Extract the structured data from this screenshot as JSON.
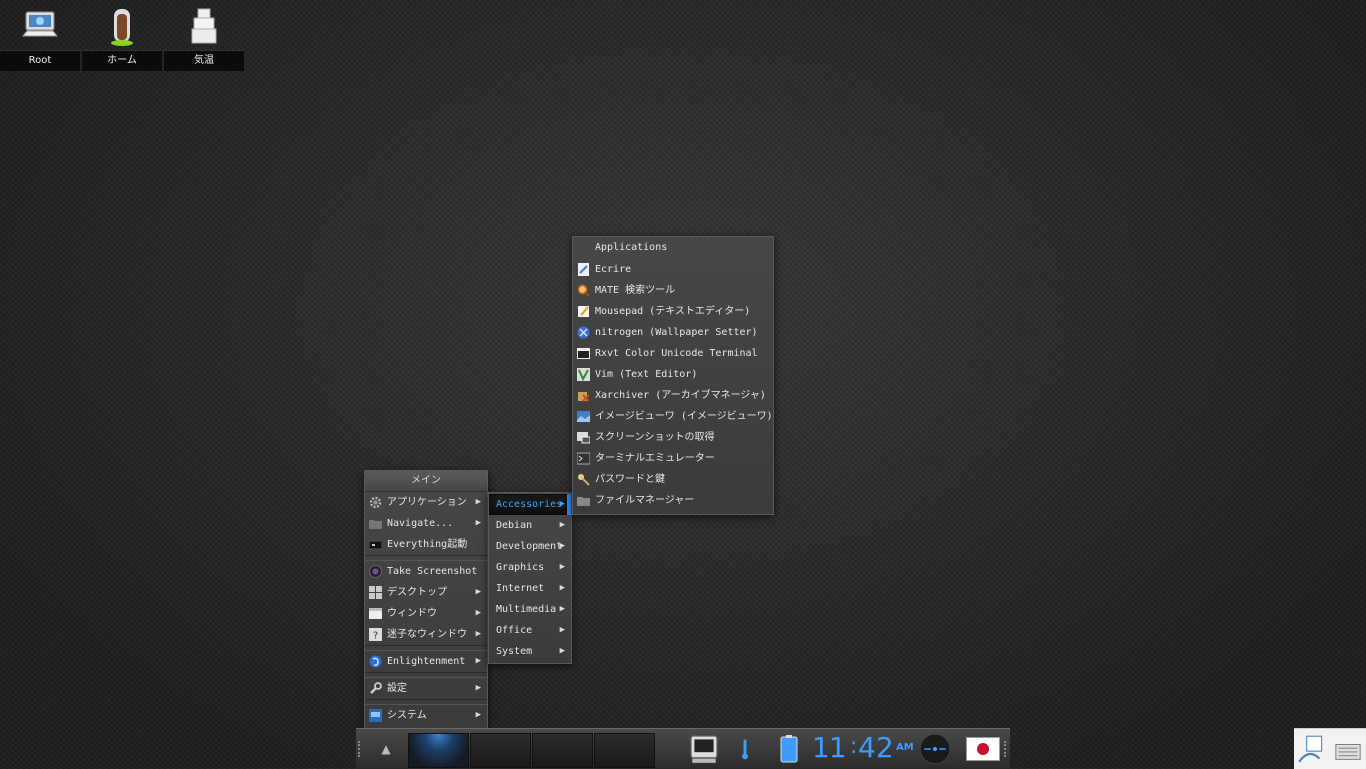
{
  "desktop_icons": [
    {
      "label": "Root",
      "icon": "computer-icon"
    },
    {
      "label": "ホーム",
      "icon": "home-door-icon"
    },
    {
      "label": "気温",
      "icon": "weather-icon"
    }
  ],
  "main_menu": {
    "title": "メイン",
    "items": [
      {
        "label": "アプリケーション",
        "icon": "gear-icon",
        "submenu": true
      },
      {
        "label": "Navigate...",
        "icon": "folder-icon",
        "submenu": true
      },
      {
        "label": "Everything起動",
        "icon": "launcher-icon",
        "submenu": false
      },
      {
        "label": "Take Screenshot",
        "icon": "camera-icon",
        "submenu": false
      },
      {
        "label": "デスクトップ",
        "icon": "desktop-grid-icon",
        "submenu": true
      },
      {
        "label": "ウィンドウ",
        "icon": "window-icon",
        "submenu": true
      },
      {
        "label": "迷子なウィンドウ",
        "icon": "question-icon",
        "submenu": true
      },
      {
        "label": "Enlightenment",
        "icon": "enlightenment-icon",
        "submenu": true
      },
      {
        "label": "設定",
        "icon": "wrench-icon",
        "submenu": true
      },
      {
        "label": "システム",
        "icon": "system-icon",
        "submenu": true
      }
    ]
  },
  "categories_menu": {
    "items": [
      {
        "label": "Accessories",
        "active": true
      },
      {
        "label": "Debian"
      },
      {
        "label": "Development"
      },
      {
        "label": "Graphics"
      },
      {
        "label": "Internet"
      },
      {
        "label": "Multimedia"
      },
      {
        "label": "Office"
      },
      {
        "label": "System"
      }
    ]
  },
  "apps_menu": {
    "title": "Applications",
    "items": [
      {
        "label": "Ecrire",
        "icon": "text-editor-icon"
      },
      {
        "label": "MATE 検索ツール",
        "icon": "search-icon"
      },
      {
        "label": "Mousepad (テキストエディター)",
        "icon": "mousepad-icon"
      },
      {
        "label": "nitrogen (Wallpaper Setter)",
        "icon": "nitrogen-icon"
      },
      {
        "label": "Rxvt Color Unicode Terminal",
        "icon": "rxvt-terminal-icon"
      },
      {
        "label": "Vim (Text Editor)",
        "icon": "vim-icon"
      },
      {
        "label": "Xarchiver (アーカイブマネージャ)",
        "icon": "archive-icon"
      },
      {
        "label": "イメージビューワ (イメージビューワ)",
        "icon": "image-viewer-icon"
      },
      {
        "label": "スクリーンショットの取得",
        "icon": "screenshot-icon"
      },
      {
        "label": "ターミナルエミュレーター",
        "icon": "terminal-icon"
      },
      {
        "label": "パスワードと鍵",
        "icon": "keys-icon"
      },
      {
        "label": "ファイルマネージャー",
        "icon": "folder-icon"
      }
    ]
  },
  "shelf": {
    "clock_hours": "11",
    "clock_minutes": "42",
    "clock_ampm": "AM",
    "active_desk": 0,
    "accent": "#3d9cff"
  }
}
